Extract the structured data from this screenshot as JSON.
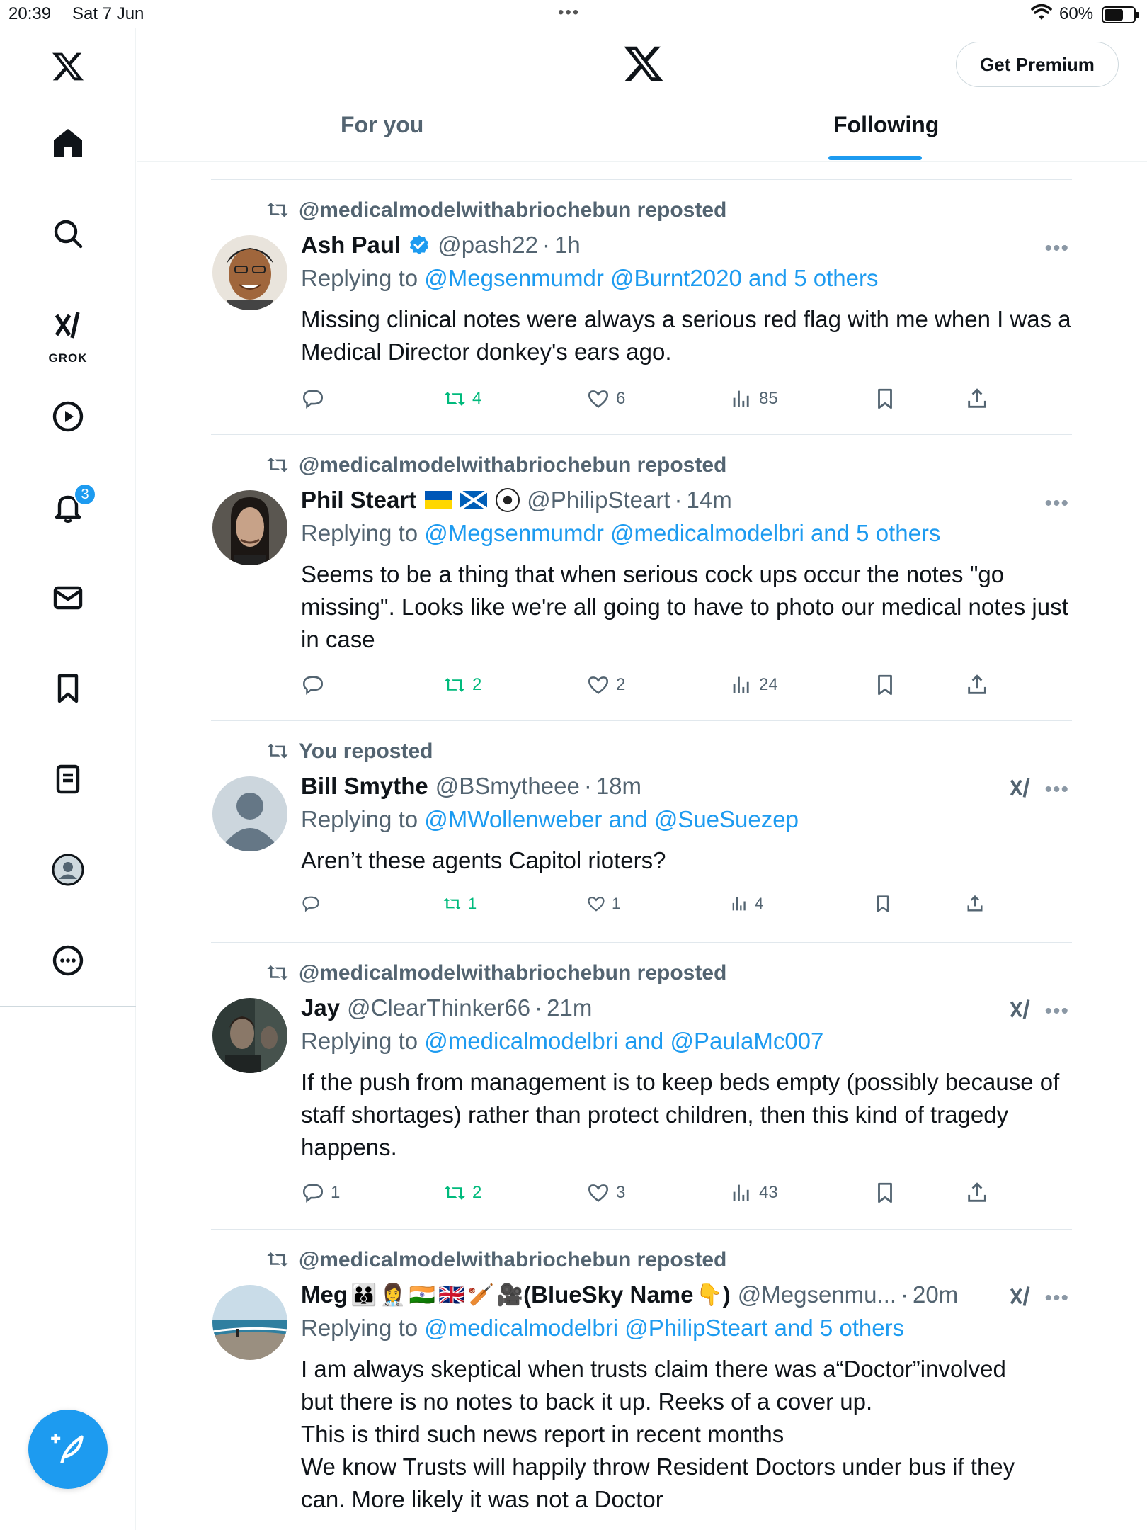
{
  "status_bar": {
    "time": "20:39",
    "date": "Sat 7 Jun",
    "battery": "60%"
  },
  "sidebar": {
    "grok_label": "GROK",
    "notification_count": "3"
  },
  "header": {
    "premium_label": "Get Premium",
    "tabs": [
      {
        "label": "For you",
        "active": false
      },
      {
        "label": "Following",
        "active": true
      }
    ]
  },
  "posts": [
    {
      "repost_by": "@medicalmodelwithabriochebun reposted",
      "name": "Ash Paul",
      "verified": true,
      "handle": "@pash22",
      "time": "1h",
      "reply_prefix": "Replying to",
      "reply_mentions": "@Megsenmumdr @Burnt2020 and 5 others",
      "text": "Missing clinical notes were always a serious red flag with me when I was a Medical Director donkey's ears ago.",
      "replies": "",
      "reposts": "4",
      "likes": "6",
      "views": "85"
    },
    {
      "repost_by": "@medicalmodelwithabriochebun reposted",
      "name": "Phil Steart",
      "handle": "@PhilipSteart",
      "time": "14m",
      "reply_prefix": "Replying to",
      "reply_mentions": "@Megsenmumdr @medicalmodelbri and 5 others",
      "text": "Seems to be a thing that when serious cock ups occur the notes \"go missing\". Looks like we're all going to have to photo our medical notes just in case",
      "replies": "",
      "reposts": "2",
      "likes": "2",
      "views": "24"
    },
    {
      "repost_by": "You reposted",
      "name": "Bill Smythe",
      "handle": "@BSmytheee",
      "time": "18m",
      "reply_prefix": "Replying to",
      "reply_mentions": "@MWollenweber and @SueSuezep",
      "text": "Aren’t these agents Capitol rioters?",
      "replies": "",
      "reposts": "1",
      "likes": "1",
      "views": "4"
    },
    {
      "repost_by": "@medicalmodelwithabriochebun reposted",
      "name": "Jay",
      "handle": "@ClearThinker66",
      "time": "21m",
      "reply_prefix": "Replying to",
      "reply_mentions": "@medicalmodelbri and @PaulaMc007",
      "text": "If the push from management is to keep beds empty (possibly because of staff shortages) rather than protect children, then this kind of tragedy happens.",
      "replies": "1",
      "reposts": "2",
      "likes": "3",
      "views": "43"
    },
    {
      "repost_by": "@medicalmodelwithabriochebun reposted",
      "name": "Meg",
      "name_suffix": "(BlueSky Name",
      "name_close": ")",
      "handle": "@Megsenmu...",
      "time": "20m",
      "reply_prefix": "Replying to",
      "reply_mentions": "@medicalmodelbri @PhilipSteart and 5 others",
      "text_lines": [
        "I am always skeptical when trusts claim there was a“Doctor”involved",
        "but there is no notes to back it up. Reeks of a cover up.",
        "This is third such news report in recent months",
        "We know Trusts will happily throw Resident Doctors under bus if they",
        "can. More likely it was not a Doctor"
      ]
    }
  ],
  "separator": "·",
  "colors": {
    "accent": "#1d9bf0",
    "repost_green": "#00ba7c",
    "muted": "#536471"
  }
}
